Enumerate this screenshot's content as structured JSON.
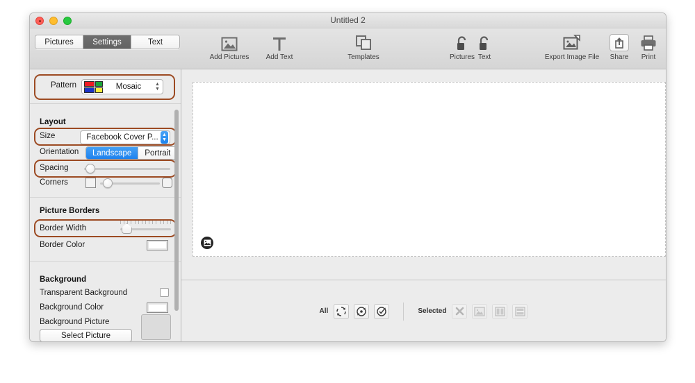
{
  "window": {
    "title": "Untitled 2",
    "traffic_lights": [
      "close-red",
      "minimize-yellow",
      "zoom-green"
    ]
  },
  "tabs": [
    {
      "label": "Pictures",
      "active": false
    },
    {
      "label": "Settings",
      "active": true
    },
    {
      "label": "Text",
      "active": false
    }
  ],
  "toolbar": {
    "items": [
      {
        "label": "Add Pictures",
        "icon": "picture-icon"
      },
      {
        "label": "Add Text",
        "icon": "text-T-icon"
      },
      {
        "label": "Templates",
        "icon": "templates-icon"
      },
      {
        "label": "Pictures",
        "icon": "unlocked-padlock-icon"
      },
      {
        "label": "Text",
        "icon": "unlocked-padlock-icon"
      },
      {
        "label": "Export Image File",
        "icon": "export-image-icon"
      },
      {
        "label": "Share",
        "icon": "share-upload-icon"
      },
      {
        "label": "Print",
        "icon": "printer-icon"
      }
    ]
  },
  "sidebar": {
    "pattern": {
      "label": "Pattern",
      "value": "Mosaic",
      "icon": "mosaic-swatch-icon",
      "mosaic_colors": [
        "#ee1b24",
        "#19a437",
        "#1b32c6",
        "#f6ed3b"
      ],
      "highlighted": true
    },
    "layout": {
      "heading": "Layout",
      "size": {
        "label": "Size",
        "value": "Facebook Cover P...",
        "highlighted": true
      },
      "orientation": {
        "label": "Orientation",
        "options": [
          "Landscape",
          "Portrait"
        ],
        "selected": "Landscape"
      },
      "spacing": {
        "label": "Spacing",
        "value_pct": 2,
        "highlighted": true
      },
      "corners": {
        "label": "Corners",
        "value_pct": 20,
        "left_icon": "square-icon",
        "right_icon": "rounded-square-icon"
      }
    },
    "picture_borders": {
      "heading": "Picture Borders",
      "border_width": {
        "label": "Border Width",
        "value_pct": 6,
        "highlighted": true
      },
      "border_color": {
        "label": "Border Color",
        "swatch": "#ffffff"
      }
    },
    "background": {
      "heading": "Background",
      "transparent": {
        "label": "Transparent Background",
        "checked": false
      },
      "color": {
        "label": "Background Color",
        "swatch": "#ffffff"
      },
      "picture": {
        "label": "Background Picture",
        "button": "Select Picture"
      }
    },
    "highlight_color": "#9c4a22"
  },
  "bottom_bar": {
    "all": {
      "label": "All",
      "buttons": [
        {
          "icon": "rotate-arrows-icon",
          "enabled": true
        },
        {
          "icon": "rotate-center-dot-icon",
          "enabled": true
        },
        {
          "icon": "rotate-check-icon",
          "enabled": true
        }
      ]
    },
    "selected": {
      "label": "Selected",
      "buttons": [
        {
          "icon": "close-x-icon",
          "enabled": false
        },
        {
          "icon": "picture-icon",
          "enabled": false
        },
        {
          "icon": "split-columns-icon",
          "enabled": false
        },
        {
          "icon": "split-rows-icon",
          "enabled": false
        }
      ]
    }
  },
  "canvas": {
    "badge_icon": "add-picture-badge-icon"
  }
}
